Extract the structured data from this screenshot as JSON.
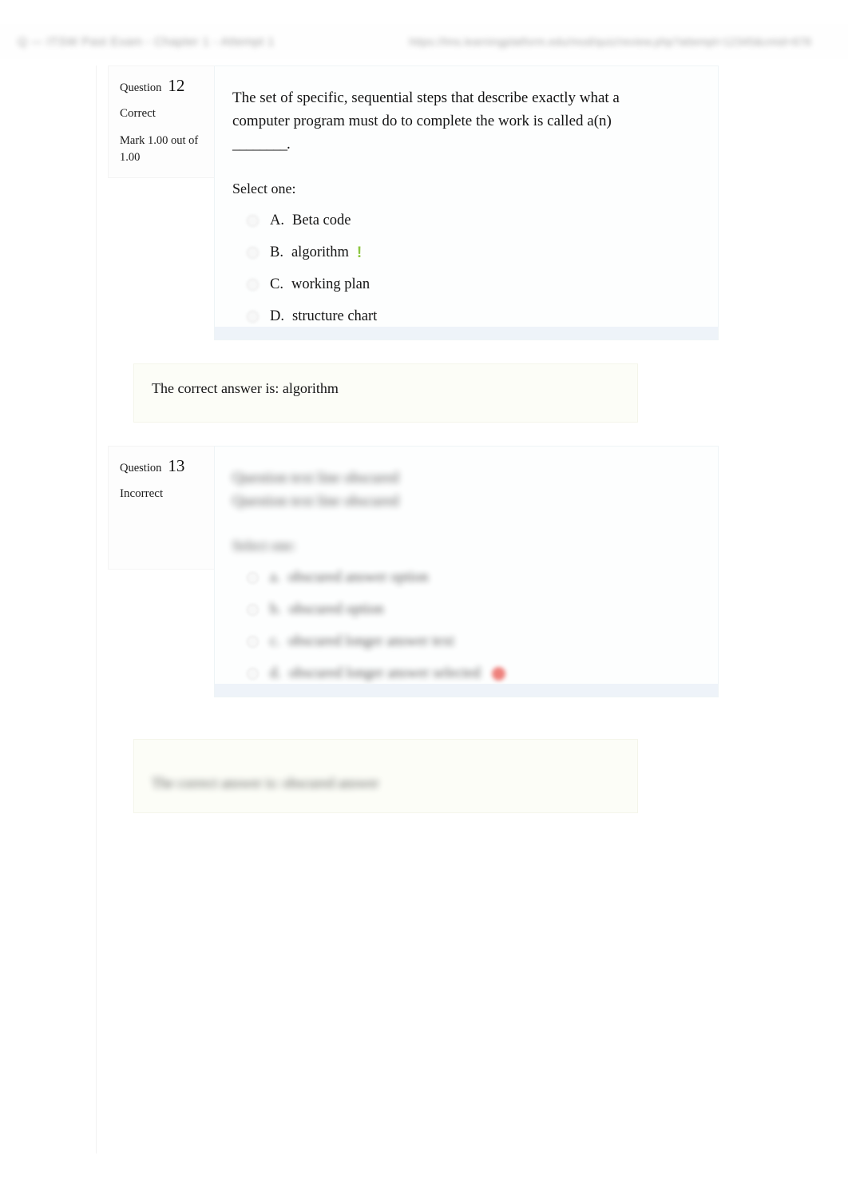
{
  "header": {
    "left_text": "Q — ITSW Past Exam - Chapter 1 - Attempt 1",
    "right_text": "https://lms.learningplatform.edu/mod/quiz/review.php?attempt=12345&cmid=678"
  },
  "questions": [
    {
      "id": "q12",
      "label": "Question",
      "number": "12",
      "state": "Correct",
      "mark_text": "Mark 1.00 out of 1.00",
      "stem": "The set of specific, sequential steps that describe exactly what a computer program must do to complete the work is called a(n) ________.",
      "stem_line1": "The set of specific, sequential steps that describe exactly what a",
      "stem_line2": "computer program must do to complete the work is called a(n)",
      "stem_line3": "________.",
      "select_prompt": "Select one:",
      "censored": false,
      "options": [
        {
          "letter": "A.",
          "text": "Beta code",
          "selected": false,
          "marker": "none"
        },
        {
          "letter": "B.",
          "text": "algorithm",
          "selected": true,
          "marker": "correct",
          "marker_glyph": "!"
        },
        {
          "letter": "C.",
          "text": "working plan",
          "selected": false,
          "marker": "none"
        },
        {
          "letter": "D.",
          "text": "structure chart",
          "selected": false,
          "marker": "none"
        }
      ],
      "feedback": "The correct answer is: algorithm"
    },
    {
      "id": "q13",
      "label": "Question",
      "number": "13",
      "state": "Incorrect",
      "mark_text": "",
      "stem_line1": "Question text line obscured",
      "stem_line2": "Question text line obscured",
      "select_prompt": "Select one:",
      "censored": true,
      "options": [
        {
          "letter": "a.",
          "text": "obscured answer option",
          "selected": false,
          "marker": "none"
        },
        {
          "letter": "b.",
          "text": "obscured option",
          "selected": false,
          "marker": "none"
        },
        {
          "letter": "c.",
          "text": "obscured longer answer text",
          "selected": false,
          "marker": "none"
        },
        {
          "letter": "d.",
          "text": "obscured longer answer selected",
          "selected": true,
          "marker": "wrong",
          "marker_glyph": ""
        }
      ],
      "feedback": "The correct answer is: obscured answer"
    }
  ],
  "colors": {
    "correct_marker": "#8cc63f",
    "wrong_marker": "#e8504a",
    "answer_block_border": "#eef4f6",
    "answer_block_foot": "#eef3f9",
    "feedback_bg": "#fcfdf7",
    "info_bg": "#fdfdfd"
  }
}
